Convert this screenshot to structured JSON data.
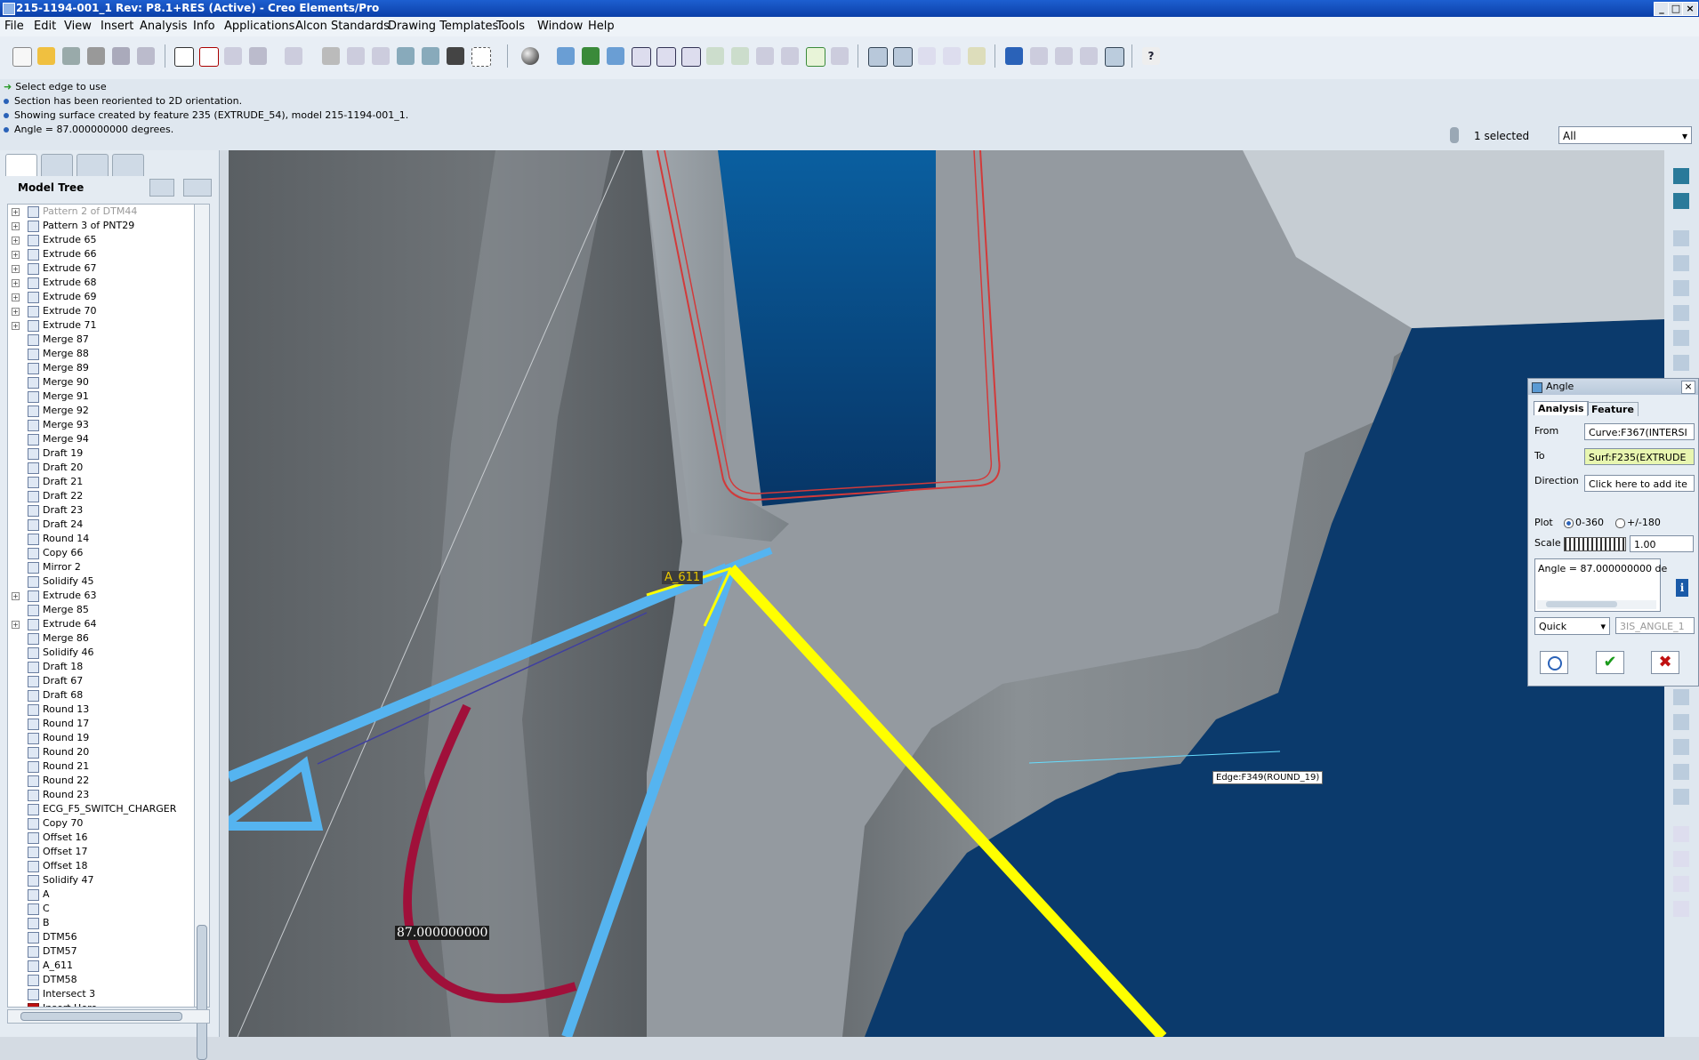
{
  "window": {
    "title": "215-1194-001_1 Rev: P8.1+RES  (Active) - Creo Elements/Pro"
  },
  "menu": [
    "File",
    "Edit",
    "View",
    "Insert",
    "Analysis",
    "Info",
    "Applications",
    "Alcon Standards",
    "Drawing Templates",
    "Tools",
    "Window",
    "Help"
  ],
  "messages": [
    "Select edge to use",
    "Section has been reoriented to 2D orientation.",
    "Showing surface created by feature 235 (EXTRUDE_54), model 215-1194-001_1.",
    "Angle = 87.000000000 degrees."
  ],
  "selection": {
    "count_label": "1 selected",
    "filter_value": "All"
  },
  "model_tree": {
    "title": "Model Tree",
    "items": [
      {
        "label": "Pattern 2 of DTM44",
        "expandable": true
      },
      {
        "label": "Pattern 3 of PNT29",
        "expandable": true
      },
      {
        "label": "Extrude 65",
        "expandable": true
      },
      {
        "label": "Extrude 66",
        "expandable": true
      },
      {
        "label": "Extrude 67",
        "expandable": true
      },
      {
        "label": "Extrude 68",
        "expandable": true
      },
      {
        "label": "Extrude 69",
        "expandable": true
      },
      {
        "label": "Extrude 70",
        "expandable": true
      },
      {
        "label": "Extrude 71",
        "expandable": true
      },
      {
        "label": "Merge 87",
        "expandable": false
      },
      {
        "label": "Merge 88",
        "expandable": false
      },
      {
        "label": "Merge 89",
        "expandable": false
      },
      {
        "label": "Merge 90",
        "expandable": false
      },
      {
        "label": "Merge 91",
        "expandable": false
      },
      {
        "label": "Merge 92",
        "expandable": false
      },
      {
        "label": "Merge 93",
        "expandable": false
      },
      {
        "label": "Merge 94",
        "expandable": false
      },
      {
        "label": "Draft 19",
        "expandable": false
      },
      {
        "label": "Draft 20",
        "expandable": false
      },
      {
        "label": "Draft 21",
        "expandable": false
      },
      {
        "label": "Draft 22",
        "expandable": false
      },
      {
        "label": "Draft 23",
        "expandable": false
      },
      {
        "label": "Draft 24",
        "expandable": false
      },
      {
        "label": "Round 14",
        "expandable": false
      },
      {
        "label": "Copy 66",
        "expandable": false
      },
      {
        "label": "Mirror 2",
        "expandable": false
      },
      {
        "label": "Solidify 45",
        "expandable": false
      },
      {
        "label": "Extrude 63",
        "expandable": true
      },
      {
        "label": "Merge 85",
        "expandable": false
      },
      {
        "label": "Extrude 64",
        "expandable": true
      },
      {
        "label": "Merge 86",
        "expandable": false
      },
      {
        "label": "Solidify 46",
        "expandable": false
      },
      {
        "label": "Draft 18",
        "expandable": false
      },
      {
        "label": "Draft 67",
        "expandable": false
      },
      {
        "label": "Draft 68",
        "expandable": false
      },
      {
        "label": "Round 13",
        "expandable": false
      },
      {
        "label": "Round 17",
        "expandable": false
      },
      {
        "label": "Round 19",
        "expandable": false
      },
      {
        "label": "Round 20",
        "expandable": false
      },
      {
        "label": "Round 21",
        "expandable": false
      },
      {
        "label": "Round 22",
        "expandable": false
      },
      {
        "label": "Round 23",
        "expandable": false
      },
      {
        "label": "ECG_F5_SWITCH_CHARGER",
        "expandable": false
      },
      {
        "label": "Copy 70",
        "expandable": false
      },
      {
        "label": "Offset 16",
        "expandable": false
      },
      {
        "label": "Offset 17",
        "expandable": false
      },
      {
        "label": "Offset 18",
        "expandable": false
      },
      {
        "label": "Solidify 47",
        "expandable": false
      },
      {
        "label": "A",
        "expandable": false
      },
      {
        "label": "C",
        "expandable": false
      },
      {
        "label": "B",
        "expandable": false
      },
      {
        "label": "DTM56",
        "expandable": false
      },
      {
        "label": "DTM57",
        "expandable": false
      },
      {
        "label": "A_611",
        "expandable": false
      },
      {
        "label": "DTM58",
        "expandable": false
      },
      {
        "label": "Intersect 3",
        "expandable": false
      },
      {
        "label": "Insert Here",
        "expandable": false
      }
    ]
  },
  "viewport": {
    "axis_label": "A_611",
    "angle_readout": "87.000000000",
    "edge_tooltip": "Edge:F349(ROUND_19)"
  },
  "angle_dialog": {
    "title": "Angle",
    "tabs": [
      "Analysis",
      "Feature"
    ],
    "from_label": "From",
    "from_value": "Curve:F367(INTERSI",
    "to_label": "To",
    "to_value": "Surf:F235(EXTRUDE",
    "direction_label": "Direction",
    "direction_value": "Click here to add ite",
    "plot_label": "Plot",
    "plot_opt1": "0-360",
    "plot_opt2": "+/-180",
    "scale_label": "Scale",
    "scale_value": "1.00",
    "result_text": "Angle = 87.000000000 de",
    "mode_value": "Quick",
    "name_value": "3IS_ANGLE_1"
  },
  "colors": {
    "measure_blue": "#55b4f0",
    "yellow": "#ffff00",
    "arc": "#a0103a",
    "navy": "#0c3a6e"
  }
}
